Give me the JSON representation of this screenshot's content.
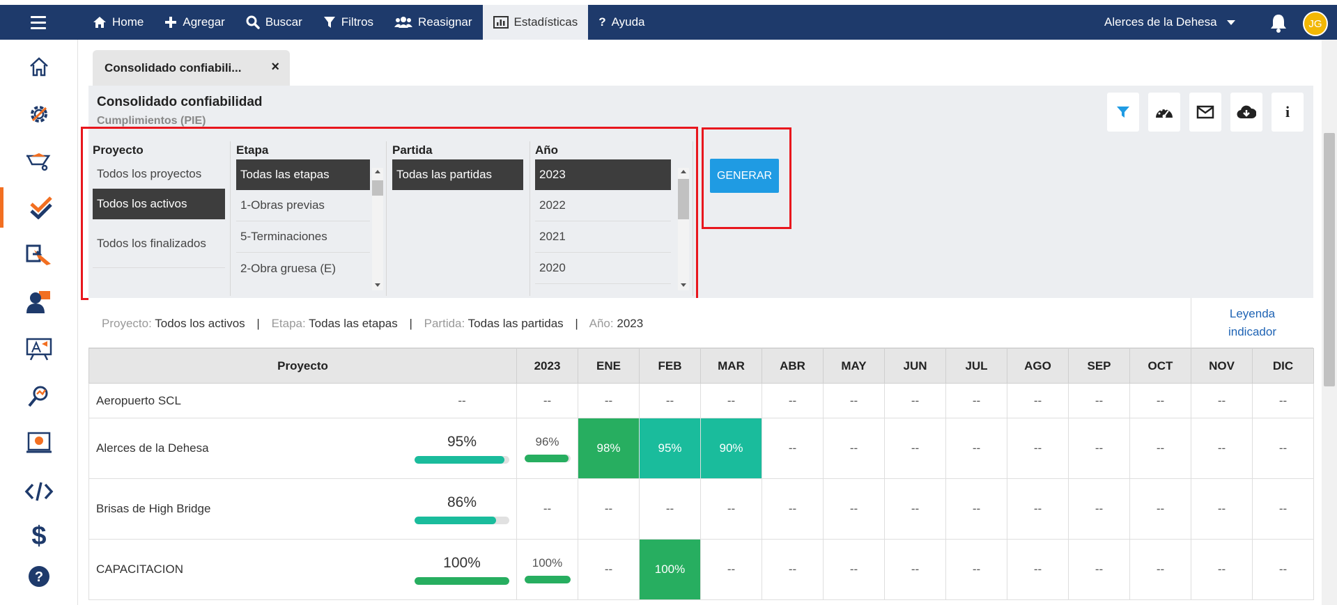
{
  "nav": {
    "items": [
      {
        "label": "Home",
        "icon": "home-icon"
      },
      {
        "label": "Agregar",
        "icon": "plus-icon"
      },
      {
        "label": "Buscar",
        "icon": "search-icon"
      },
      {
        "label": "Filtros",
        "icon": "filter-icon"
      },
      {
        "label": "Reasignar",
        "icon": "users-icon"
      },
      {
        "label": "Estadísticas",
        "icon": "bar-chart-icon"
      },
      {
        "label": "Ayuda",
        "icon": "question-icon"
      }
    ],
    "active": "Estadísticas",
    "project": "Alerces de la Dehesa",
    "avatar": "JG"
  },
  "colors": {
    "navbar": "#1e3a6b",
    "accent": "#f26f21",
    "green_dark": "#27ae60",
    "green_teal": "#1abc9c",
    "button_blue": "#1f9be3"
  },
  "tab": {
    "label": "Consolidado confiabili...",
    "close": "×"
  },
  "panel": {
    "title": "Consolidado confiabilidad",
    "subtitle": "Cumplimientos (PIE)"
  },
  "filters": {
    "proyecto": {
      "header": "Proyecto",
      "options": [
        "Todos los proyectos",
        "Todos los activos",
        "Todos los finalizados"
      ],
      "selected": "Todos los activos"
    },
    "etapa": {
      "header": "Etapa",
      "options": [
        "Todas las etapas",
        "1-Obras previas",
        "5-Terminaciones",
        "2-Obra gruesa (E)"
      ],
      "selected": "Todas las etapas"
    },
    "partida": {
      "header": "Partida",
      "options": [
        "Todas las partidas"
      ],
      "selected": "Todas las partidas"
    },
    "anio": {
      "header": "Año",
      "options": [
        "2023",
        "2022",
        "2021",
        "2020"
      ],
      "selected": "2023"
    }
  },
  "generate_label": "GENERAR",
  "summary": {
    "proyecto_label": "Proyecto:",
    "proyecto_value": "Todos los activos",
    "etapa_label": "Etapa:",
    "etapa_value": "Todas las etapas",
    "partida_label": "Partida:",
    "partida_value": "Todas las partidas",
    "anio_label": "Año:",
    "anio_value": "2023",
    "separator": "|",
    "legend_link": "Leyenda indicador"
  },
  "table": {
    "headers": [
      "Proyecto",
      "2023",
      "ENE",
      "FEB",
      "MAR",
      "ABR",
      "MAY",
      "JUN",
      "JUL",
      "AGO",
      "SEP",
      "OCT",
      "NOV",
      "DIC"
    ],
    "rows": [
      {
        "name": "Aeropuerto SCL",
        "total": "--",
        "total_fill": null,
        "year": "--",
        "year_fill": null,
        "months": [
          "--",
          "--",
          "--",
          "--",
          "--",
          "--",
          "--",
          "--",
          "--",
          "--",
          "--",
          "--"
        ]
      },
      {
        "name": "Alerces de la Dehesa",
        "total": "95%",
        "total_fill": 0.95,
        "year": "96%",
        "year_fill": 0.96,
        "months": [
          "98%",
          "95%",
          "90%",
          "--",
          "--",
          "--",
          "--",
          "--",
          "--",
          "--",
          "--",
          "--"
        ],
        "month_colors": [
          "#27ae60",
          "#1abc9c",
          "#1abc9c"
        ]
      },
      {
        "name": "Brisas de High Bridge",
        "total": "86%",
        "total_fill": 0.86,
        "year": "--",
        "year_fill": null,
        "months": [
          "--",
          "--",
          "--",
          "--",
          "--",
          "--",
          "--",
          "--",
          "--",
          "--",
          "--",
          "--"
        ]
      },
      {
        "name": "CAPACITACION",
        "total": "100%",
        "total_fill": 1.0,
        "year": "100%",
        "year_fill": 1.0,
        "months": [
          "--",
          "100%",
          "--",
          "--",
          "--",
          "--",
          "--",
          "--",
          "--",
          "--",
          "--",
          "--"
        ],
        "month_colors": [
          null,
          "#27ae60"
        ]
      }
    ]
  }
}
